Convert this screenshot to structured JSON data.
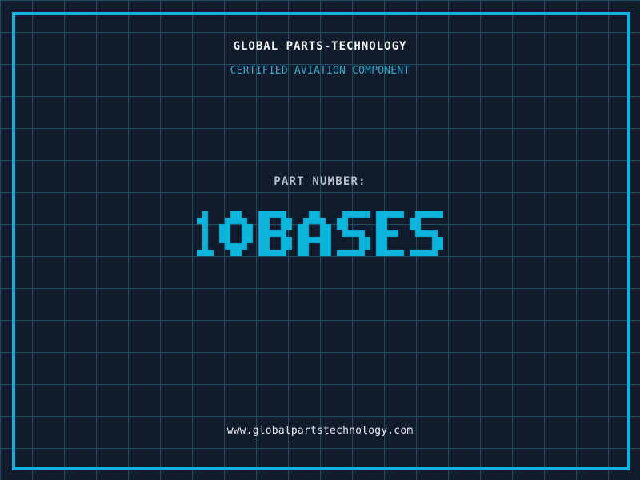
{
  "header": {
    "title": "GLOBAL PARTS-TECHNOLOGY",
    "subtitle": "CERTIFIED AVIATION COMPONENT"
  },
  "part_number": {
    "label": "PART NUMBER:",
    "value": "10BASES"
  },
  "footer": {
    "url": "www.globalpartstechnology.com"
  },
  "colors": {
    "background": "#101b2b",
    "grid_line": "#1d4f62",
    "frame": "#0cb2dc",
    "title": "#f5f7f9",
    "subtitle": "#2badd0",
    "part_label": "#b9c2cc",
    "pixel_text": "#0db4dc",
    "url": "#e8ebee"
  }
}
